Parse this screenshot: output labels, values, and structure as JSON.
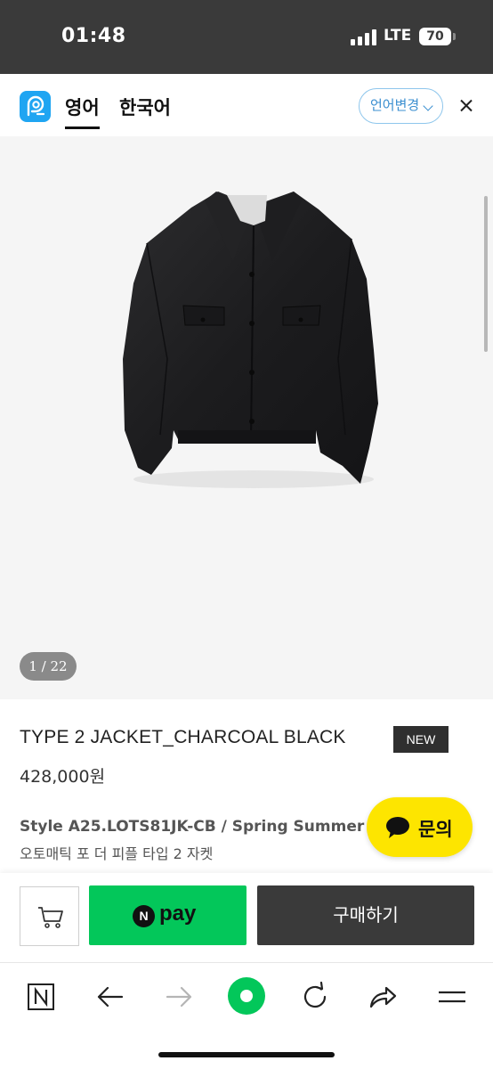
{
  "status_bar": {
    "time": "01:48",
    "network": "LTE",
    "battery": "70"
  },
  "translate_bar": {
    "tabs": [
      {
        "label": "영어",
        "active": true
      },
      {
        "label": "한국어",
        "active": false
      }
    ],
    "change_language_label": "언어변경",
    "icons": {
      "logo": "papago-logo-icon",
      "close": "close-icon"
    }
  },
  "product": {
    "image_counter": "1 / 22",
    "title": "TYPE 2 JACKET_CHARCOAL BLACK",
    "badge": "NEW",
    "price": "428,000원",
    "style_line": "Style A25.LOTS81JK-CB / Spring Summer 20",
    "description": "오토매틱 포 더 피플 타입 2 자켓"
  },
  "chat_button": {
    "label": "문의",
    "icon": "speech-bubble-icon",
    "color": "#fde500"
  },
  "purchase_bar": {
    "cart_icon": "cart-icon",
    "npay": {
      "badge": "N",
      "label": "pay",
      "color": "#03c75a"
    },
    "buy_label": "구매하기"
  },
  "browser_toolbar": {
    "items": [
      "naver-home-icon",
      "back-arrow-icon",
      "forward-arrow-icon",
      "green-dot-icon",
      "refresh-icon",
      "share-icon",
      "menu-icon"
    ]
  }
}
